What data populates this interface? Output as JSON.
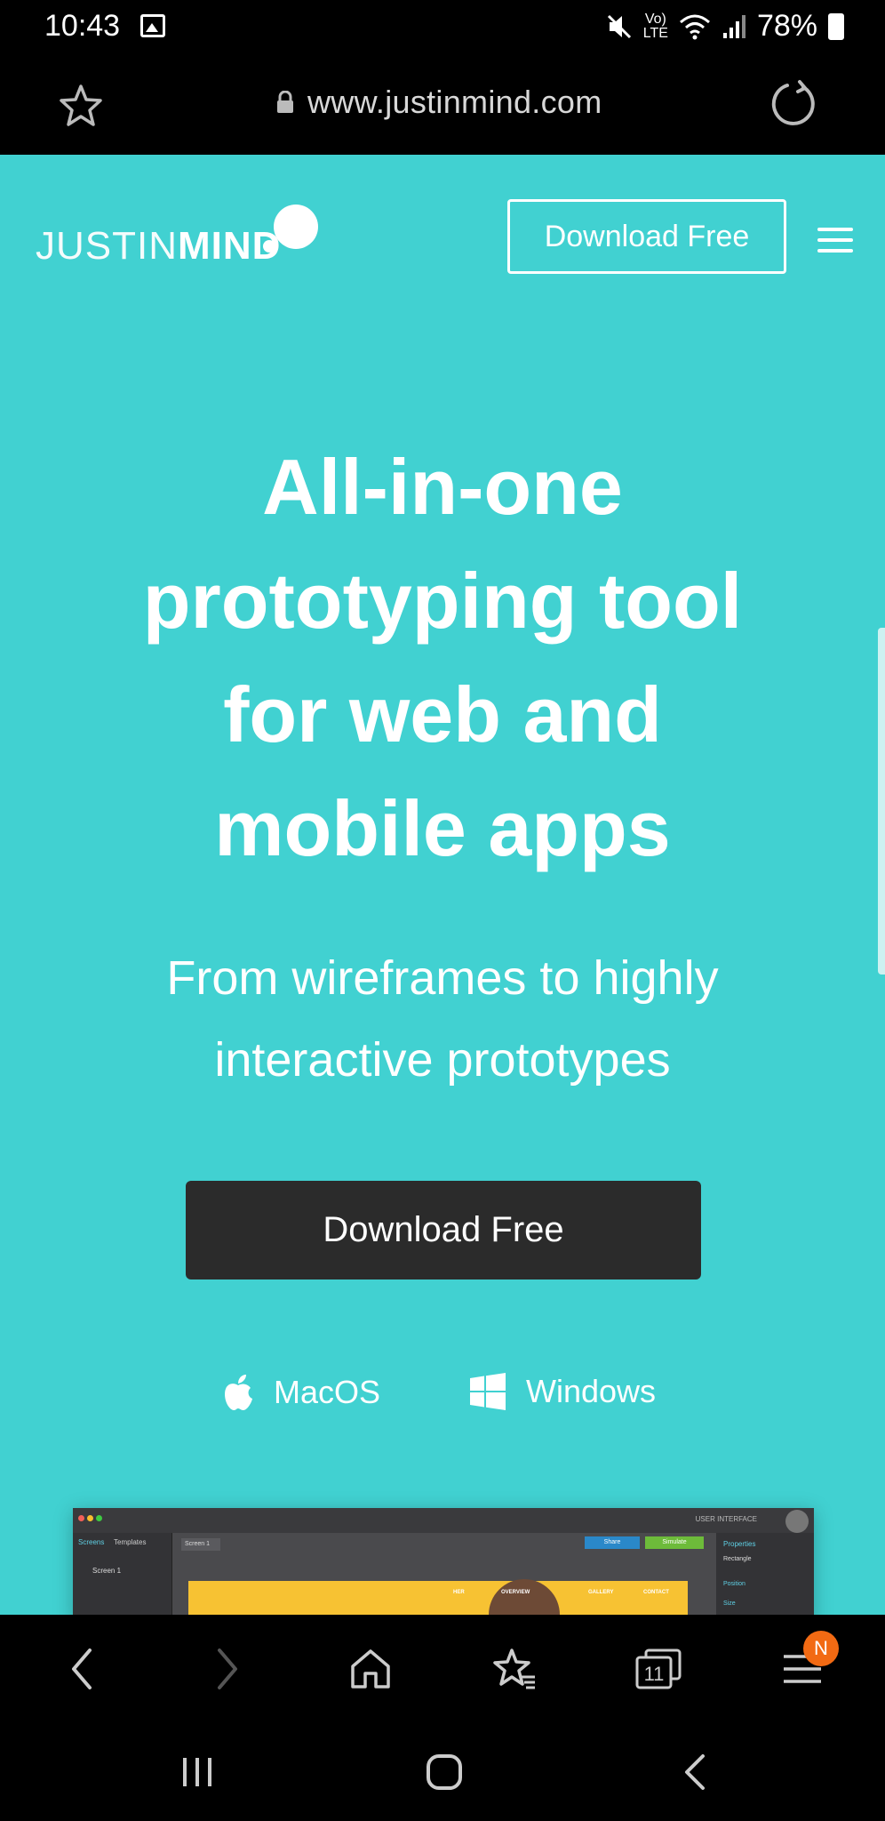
{
  "status_bar": {
    "time": "10:43",
    "volte_line1": "Vo)",
    "volte_line2": "LTE",
    "battery": "78%"
  },
  "browser": {
    "url": "www.justinmind.com",
    "tab_count": "11",
    "notification_badge": "N"
  },
  "site": {
    "logo_thin": "JUSTIN",
    "logo_bold": "MIND",
    "header_cta": "Download Free",
    "hero_title_lines": [
      "All-in-one",
      "prototyping tool",
      "for web and",
      "mobile apps"
    ],
    "hero_subtitle_lines": [
      "From wireframes to highly",
      "interactive prototypes"
    ],
    "hero_cta": "Download Free",
    "platforms": [
      "MacOS",
      "Windows"
    ]
  },
  "preview": {
    "tab_screens": "Screens",
    "tab_templates": "Templates",
    "screen_item": "Screen 1",
    "canvas_tab": "Screen 1",
    "share": "Share",
    "simulate": "Simulate",
    "ui_label": "USER INTERFACE",
    "properties": "Properties",
    "element": "Rectangle",
    "position": "Position",
    "size": "Size",
    "nav_items": [
      "HER",
      "OVERVIEW",
      "GALLERY",
      "CONTACT"
    ]
  },
  "colors": {
    "brand_teal": "#41d1d1",
    "cta_dark": "#2b2b2b",
    "badge_orange": "#f26a13"
  },
  "icons": {
    "bookmark": "star-icon",
    "lock": "lock-icon",
    "reload": "reload-icon",
    "menu": "hamburger-icon",
    "apple": "apple-icon",
    "windows": "windows-icon",
    "back": "chevron-left-icon",
    "forward": "chevron-right-icon",
    "home": "home-icon",
    "bookmarks": "bookmarks-star-icon",
    "tabs": "tabs-icon",
    "browser_menu": "menu-icon",
    "recents": "recents-icon",
    "android_home": "android-home-icon",
    "android_back": "android-back-icon"
  }
}
